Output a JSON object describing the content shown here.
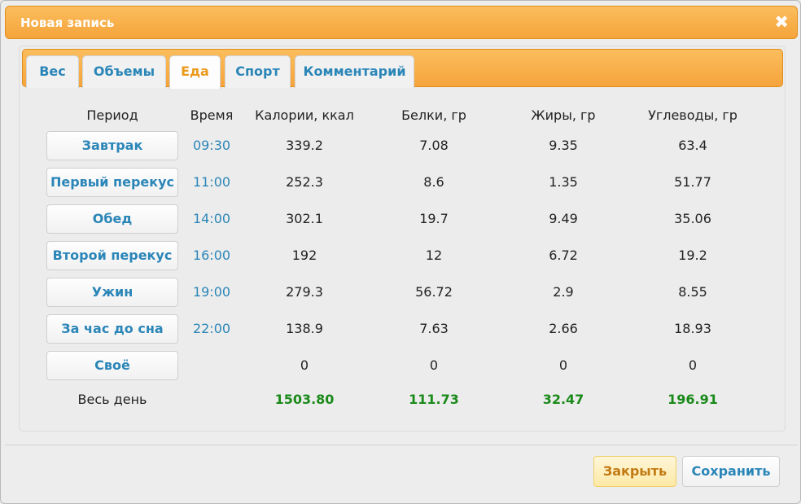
{
  "dialog": {
    "title": "Новая запись",
    "close_glyph": "✖"
  },
  "tabs": [
    {
      "label": "Вес",
      "active": false
    },
    {
      "label": "Объемы",
      "active": false
    },
    {
      "label": "Еда",
      "active": true
    },
    {
      "label": "Спорт",
      "active": false
    },
    {
      "label": "Комментарий",
      "active": false
    }
  ],
  "table": {
    "headers": [
      "Период",
      "Время",
      "Калории, ккал",
      "Белки, гр",
      "Жиры, гр",
      "Углеводы, гр"
    ],
    "rows": [
      {
        "period": "Завтрак",
        "time": "09:30",
        "calories": "339.2",
        "protein": "7.08",
        "fat": "9.35",
        "carbs": "63.4"
      },
      {
        "period": "Первый перекус",
        "time": "11:00",
        "calories": "252.3",
        "protein": "8.6",
        "fat": "1.35",
        "carbs": "51.77"
      },
      {
        "period": "Обед",
        "time": "14:00",
        "calories": "302.1",
        "protein": "19.7",
        "fat": "9.49",
        "carbs": "35.06"
      },
      {
        "period": "Второй перекус",
        "time": "16:00",
        "calories": "192",
        "protein": "12",
        "fat": "6.72",
        "carbs": "19.2"
      },
      {
        "period": "Ужин",
        "time": "19:00",
        "calories": "279.3",
        "protein": "56.72",
        "fat": "2.9",
        "carbs": "8.55"
      },
      {
        "period": "За час до сна",
        "time": "22:00",
        "calories": "138.9",
        "protein": "7.63",
        "fat": "2.66",
        "carbs": "18.93"
      },
      {
        "period": "Своё",
        "time": "",
        "calories": "0",
        "protein": "0",
        "fat": "0",
        "carbs": "0"
      }
    ],
    "total": {
      "label": "Весь день",
      "calories": "1503.80",
      "protein": "111.73",
      "fat": "32.47",
      "carbs": "196.91"
    }
  },
  "buttons": {
    "close_label": "Закрыть",
    "save_label": "Сохранить"
  },
  "colors": {
    "accent_orange": "#f5a43b",
    "link_blue": "#2b86b8",
    "active_tab_orange": "#ea9a1d",
    "total_green": "#1a8a1a"
  }
}
